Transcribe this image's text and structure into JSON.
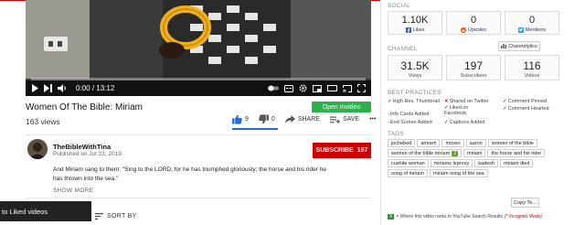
{
  "player": {
    "time_current": "0:00",
    "time_total": "13:12",
    "time_sep": "/",
    "progress": 0.0
  },
  "video": {
    "title": "Women Of The Bible: Miriam",
    "open_invideo_label": "Open Invideo",
    "views": "163 views",
    "likes": "9",
    "dislikes": "0",
    "share_label": "SHARE",
    "save_label": "SAVE",
    "more_label": "•••",
    "like_ratio": 1.0
  },
  "channel": {
    "name": "TheBibleWithTina",
    "published": "Published on Jul 23, 2019",
    "subscribe_label": "SUBSCRIBE",
    "subscriber_count": "197"
  },
  "description": {
    "text": "And Miriam sang to them: \"Sing to the LORD, for he has triumphed gloriously; the horse and his rider he has thrown into the sea.\"",
    "show_more": "SHOW MORE"
  },
  "comments": {
    "sort_by": "SORT BY"
  },
  "toast": {
    "text": "to Liked videos"
  },
  "panel": {
    "social": {
      "label": "SOCIAL",
      "likes_value": "1.10K",
      "likes_label": "Likes",
      "upvotes_value": "0",
      "upvotes_label": "Upvotes",
      "mentions_value": "0",
      "mentions_label": "Mentions"
    },
    "channel": {
      "label": "CHANNEL",
      "channelytics_label": "Channelytics",
      "views_value": "31.5K",
      "views_label": "Views",
      "subs_value": "197",
      "subs_label": "Subscribers",
      "videos_value": "116",
      "videos_label": "Videos"
    },
    "best_practices": {
      "label": "BEST PRACTICES",
      "items": [
        {
          "mark": "✓",
          "status": "ok",
          "text": "High Res. Thumbnail"
        },
        {
          "mark": "-",
          "status": "ok",
          "text": "Info Cards Added"
        },
        {
          "mark": "-",
          "status": "ok",
          "text": "End Screen Added"
        },
        {
          "mark": "✕",
          "status": "no",
          "text": "Shared on Twitter"
        },
        {
          "mark": "✓",
          "status": "ok",
          "text": "Liked on Facebook"
        },
        {
          "mark": "✓",
          "status": "ok",
          "text": "Captions Added"
        },
        {
          "mark": "✓",
          "status": "ok",
          "text": "Comment Pinned"
        },
        {
          "mark": "✓",
          "status": "ok",
          "text": "Comment Hearted"
        }
      ]
    },
    "tags": {
      "label": "TAGS",
      "items": [
        {
          "text": "jochebed"
        },
        {
          "text": "amram"
        },
        {
          "text": "moses"
        },
        {
          "text": "aaron"
        },
        {
          "text": "women of the bible"
        },
        {
          "text": "women of the bible miriam",
          "num": "3"
        },
        {
          "text": "miriam"
        },
        {
          "text": "the horse and his rider"
        },
        {
          "text": "cushite woman"
        },
        {
          "text": "miriams leprosy"
        },
        {
          "text": "kadesh"
        },
        {
          "text": "miriam died"
        },
        {
          "text": "song of miriam"
        },
        {
          "text": "miriam song of the sea"
        }
      ],
      "copy_label": "Copy To..."
    },
    "rank_note": {
      "badge": "X",
      "text": "= Where this video ranks in YouTube Search Results",
      "link": "(* Incognito Mode)"
    }
  },
  "colors": {
    "subscribe": "#cc0000",
    "open_invideo": "#2bb24c",
    "like_blue": "#1e6fd9",
    "progress_red": "#ee0000"
  }
}
